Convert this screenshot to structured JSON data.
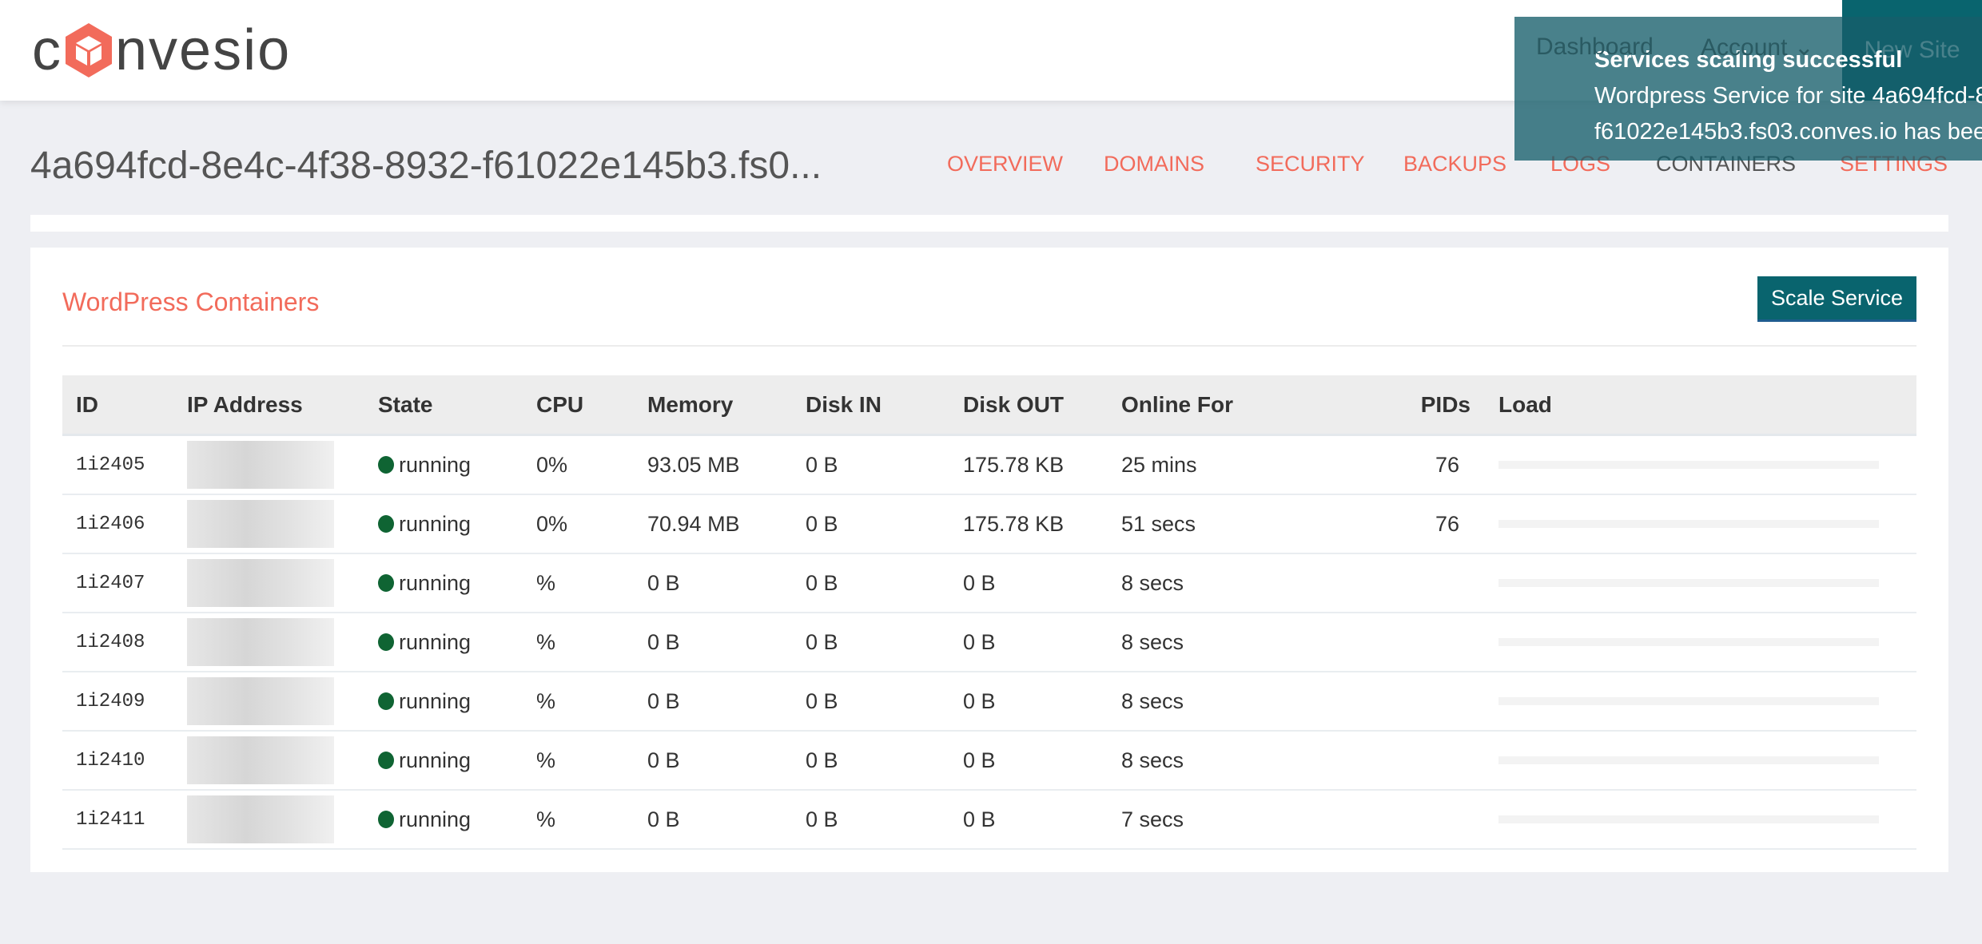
{
  "header": {
    "logo": "convesio",
    "links": [
      "Dashboard",
      "Account"
    ],
    "account_chevron": "chevron-down-icon",
    "new_site": "New Site"
  },
  "page": {
    "title": "4a694fcd-8e4c-4f38-8932-f61022e145b3.fs0...",
    "nav": [
      "OVERVIEW",
      "DOMAINS",
      "SECURITY",
      "BACKUPS",
      "LOGS",
      "CONTAINERS",
      "SETTINGS"
    ],
    "active_nav": "CONTAINERS"
  },
  "card": {
    "title": "WordPress Containers",
    "scale_button": "Scale Service"
  },
  "table": {
    "columns": [
      "ID",
      "IP Address",
      "State",
      "CPU",
      "Memory",
      "Disk IN",
      "Disk OUT",
      "Online For",
      "PIDs",
      "Load"
    ],
    "rows": [
      {
        "id": "1i2405",
        "state": "running",
        "cpu": "0%",
        "memory": "93.05 MB",
        "disk_in": "0 B",
        "disk_out": "175.78 KB",
        "online": "25 mins",
        "pids": "76"
      },
      {
        "id": "1i2406",
        "state": "running",
        "cpu": "0%",
        "memory": "70.94 MB",
        "disk_in": "0 B",
        "disk_out": "175.78 KB",
        "online": "51 secs",
        "pids": "76"
      },
      {
        "id": "1i2407",
        "state": "running",
        "cpu": "%",
        "memory": "0 B",
        "disk_in": "0 B",
        "disk_out": "0 B",
        "online": "8 secs",
        "pids": ""
      },
      {
        "id": "1i2408",
        "state": "running",
        "cpu": "%",
        "memory": "0 B",
        "disk_in": "0 B",
        "disk_out": "0 B",
        "online": "8 secs",
        "pids": ""
      },
      {
        "id": "1i2409",
        "state": "running",
        "cpu": "%",
        "memory": "0 B",
        "disk_in": "0 B",
        "disk_out": "0 B",
        "online": "8 secs",
        "pids": ""
      },
      {
        "id": "1i2410",
        "state": "running",
        "cpu": "%",
        "memory": "0 B",
        "disk_in": "0 B",
        "disk_out": "0 B",
        "online": "8 secs",
        "pids": ""
      },
      {
        "id": "1i2411",
        "state": "running",
        "cpu": "%",
        "memory": "0 B",
        "disk_in": "0 B",
        "disk_out": "0 B",
        "online": "7 secs",
        "pids": ""
      }
    ]
  },
  "toast": {
    "title": "Services scaling successful",
    "line1": "Wordpress Service for site 4a694fcd-8",
    "line2": "f61022e145b3.fs03.conves.io has bee"
  },
  "colors": {
    "accent": "#f26b5b",
    "brand": "#09646e",
    "running": "#0f6433"
  }
}
